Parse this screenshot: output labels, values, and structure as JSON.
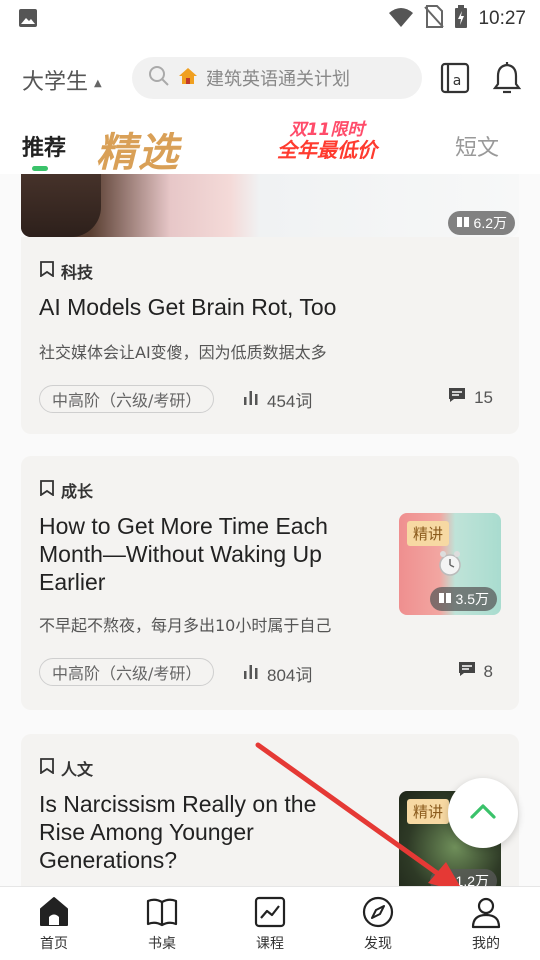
{
  "status_bar": {
    "time": "10:27"
  },
  "header": {
    "grade": "大学生",
    "search_placeholder": "建筑英语通关计划"
  },
  "tabs": {
    "recommend": "推荐",
    "featured": "精选",
    "promo_line1": "双11限时",
    "promo_line2": "全年最低价",
    "short": "短文"
  },
  "feed": {
    "top_card": {
      "reads": "6.2万"
    },
    "articles": [
      {
        "category": "科技",
        "title": "AI Models Get Brain Rot, Too",
        "subtitle": "社交媒体会让AI变傻，因为低质数据太多",
        "level": "中高阶（六级/考研）",
        "words": "454词",
        "comments": "15"
      },
      {
        "category": "成长",
        "title_lines": [
          "How to Get More Time Each",
          "Month—Without Waking Up",
          "Earlier"
        ],
        "subtitle": "不早起不熬夜，每月多出10小时属于自己",
        "level": "中高阶（六级/考研）",
        "words": "804词",
        "comments": "8",
        "thumb_tag": "精讲",
        "reads": "3.5万"
      },
      {
        "category": "人文",
        "title_lines": [
          "Is Narcissism Really on the",
          "Rise Among Younger",
          "Generations?"
        ],
        "thumb_tag": "精讲",
        "reads": "1.2万"
      }
    ]
  },
  "bottom_nav": [
    {
      "label": "首页",
      "icon": "home-icon"
    },
    {
      "label": "书桌",
      "icon": "book-icon"
    },
    {
      "label": "课程",
      "icon": "course-icon"
    },
    {
      "label": "发现",
      "icon": "compass-icon"
    },
    {
      "label": "我的",
      "icon": "person-icon"
    }
  ],
  "colors": {
    "accent_green": "#3ac26a",
    "arrow_red": "#e53935"
  }
}
